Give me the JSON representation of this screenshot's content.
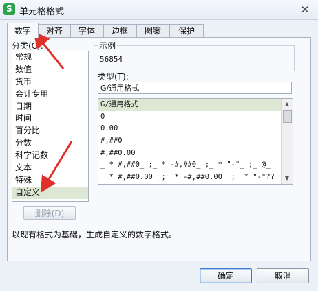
{
  "window": {
    "title": "单元格格式",
    "app_icon": "S",
    "close_glyph": "✕"
  },
  "tabs": [
    {
      "label": "数字",
      "active": true
    },
    {
      "label": "对齐",
      "active": false
    },
    {
      "label": "字体",
      "active": false
    },
    {
      "label": "边框",
      "active": false
    },
    {
      "label": "图案",
      "active": false
    },
    {
      "label": "保护",
      "active": false
    }
  ],
  "category": {
    "label": "分类(C):",
    "items": [
      "常规",
      "数值",
      "货币",
      "会计专用",
      "日期",
      "时间",
      "百分比",
      "分数",
      "科学记数",
      "文本",
      "特殊",
      "自定义"
    ],
    "selected_index": 11
  },
  "sample": {
    "label": "示例",
    "value": "56854"
  },
  "type": {
    "label": "类型(T):",
    "input_value": "G/通用格式",
    "items": [
      "G/通用格式",
      "0",
      "0.00",
      "#,##0",
      "#,##0.00",
      "_ * #,##0_ ;_ * -#,##0_ ;_ * \"-\"_ ;_ @_",
      "_ * #,##0.00_ ;_ * -#,##0.00_ ;_ * \"-\"??"
    ],
    "selected_index": 0
  },
  "buttons": {
    "delete": "删除(D)",
    "ok": "确定",
    "cancel": "取消"
  },
  "description": "以现有格式为基础，生成自定义的数字格式。",
  "annotation_color": "#e0302a"
}
